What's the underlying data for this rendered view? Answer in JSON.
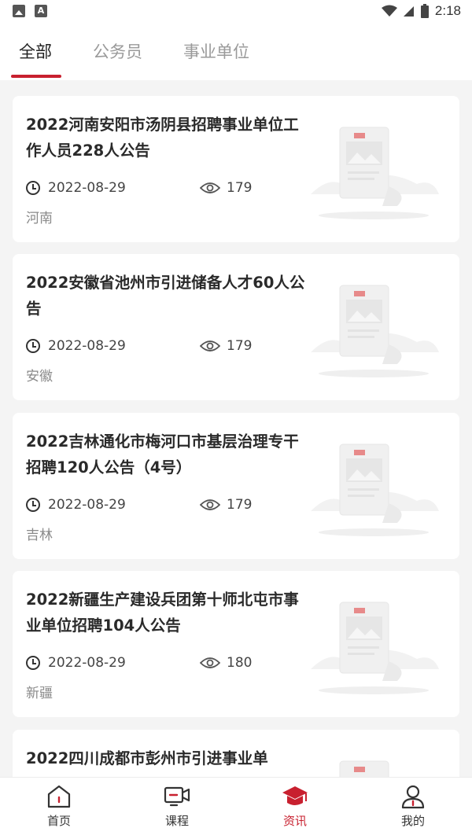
{
  "status_bar": {
    "time": "2:18"
  },
  "tabs": [
    {
      "label": "全部",
      "active": true
    },
    {
      "label": "公务员",
      "active": false
    },
    {
      "label": "事业单位",
      "active": false
    }
  ],
  "accent_color": "#c8202f",
  "articles": [
    {
      "title": "2022河南安阳市汤阴县招聘事业单位工作人员228人公告",
      "date": "2022-08-29",
      "views": "179",
      "region": "河南"
    },
    {
      "title": "2022安徽省池州市引进储备人才60人公告",
      "date": "2022-08-29",
      "views": "179",
      "region": "安徽"
    },
    {
      "title": "2022吉林通化市梅河口市基层治理专干招聘120人公告（4号）",
      "date": "2022-08-29",
      "views": "179",
      "region": "吉林"
    },
    {
      "title": "2022新疆生产建设兵团第十师北屯市事业单位招聘104人公告",
      "date": "2022-08-29",
      "views": "180",
      "region": "新疆"
    },
    {
      "title": "2022四川成都市彭州市引进事业单",
      "date": "",
      "views": "",
      "region": ""
    }
  ],
  "bottom_nav": [
    {
      "label": "首页",
      "icon": "home-icon",
      "active": false
    },
    {
      "label": "课程",
      "icon": "course-icon",
      "active": false
    },
    {
      "label": "资讯",
      "icon": "graduation-cap-icon",
      "active": true
    },
    {
      "label": "我的",
      "icon": "profile-icon",
      "active": false
    }
  ]
}
